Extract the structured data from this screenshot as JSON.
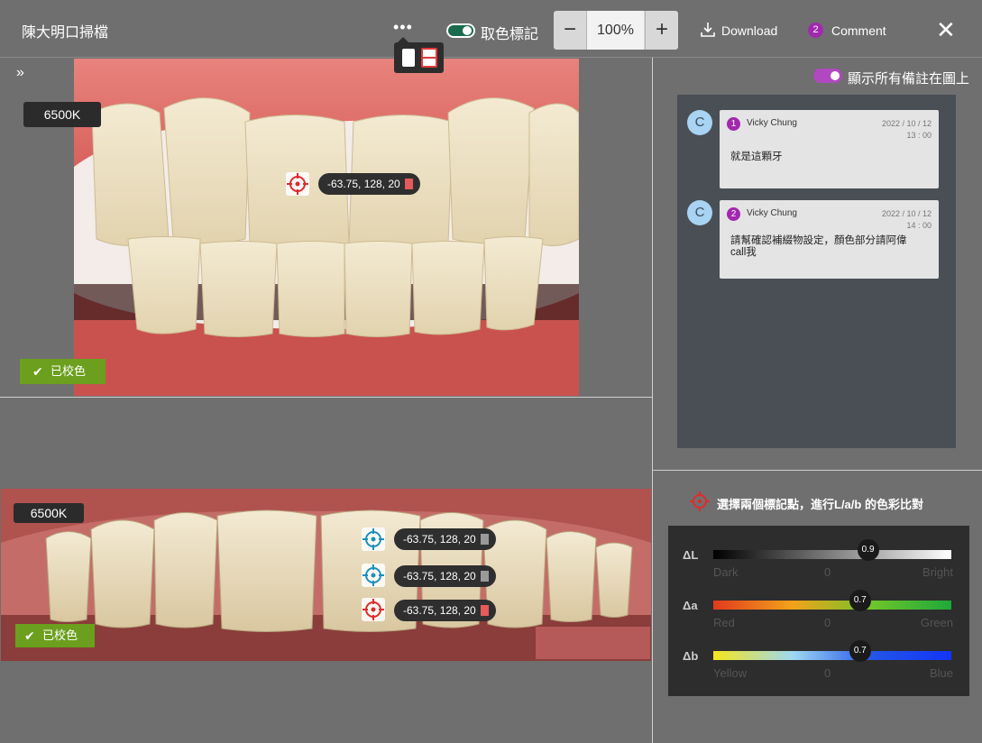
{
  "header": {
    "title": "陳大明口掃檔",
    "more_label": "•••",
    "color_marker_label": "取色標記",
    "zoom_minus": "−",
    "zoom_value": "100%",
    "zoom_plus": "+",
    "download_label": "Download",
    "comment_count": "2",
    "comment_label": "Comment",
    "close_label": "✕"
  },
  "images": {
    "expand_label": "»",
    "top": {
      "kelvin": "6500K",
      "calibrated": "已校色",
      "marker": {
        "color": "#e02b2b",
        "readout": "-63.75, 128, 20"
      }
    },
    "bottom": {
      "kelvin": "6500K",
      "calibrated": "已校色",
      "markers": [
        {
          "color": "#1b8fbf",
          "readout": "-63.75, 128, 20"
        },
        {
          "color": "#1b8fbf",
          "readout": "-63.75, 128, 20"
        },
        {
          "color": "#e02b2b",
          "readout": "-63.75, 128, 20"
        }
      ]
    }
  },
  "comments_panel": {
    "show_all_label": "顯示所有備註在圖上",
    "comments": [
      {
        "avatar": "C",
        "num": "1",
        "author": "Vicky Chung",
        "date": "2022 / 10 / 12",
        "time": "13 : 00",
        "text": "就是這顆牙"
      },
      {
        "avatar": "C",
        "num": "2",
        "author": "Vicky Chung",
        "date": "2022 / 10 / 12",
        "time": "14 : 00",
        "text": "請幫確認補綴物設定，顏色部分請阿偉call我"
      }
    ]
  },
  "compare": {
    "title": "選擇兩個標記點，進行L/a/b 的色彩比對",
    "rows": [
      {
        "label": "ΔL",
        "value": 0.9,
        "value_label": "0.9",
        "min": "Dark",
        "zero": "0",
        "max": "Bright"
      },
      {
        "label": "Δa",
        "value": 0.7,
        "value_label": "0.7",
        "min": "Red",
        "zero": "0",
        "max": "Green"
      },
      {
        "label": "Δb",
        "value": 0.7,
        "value_label": "0.7",
        "min": "Yellow",
        "zero": "0",
        "max": "Blue"
      }
    ]
  }
}
